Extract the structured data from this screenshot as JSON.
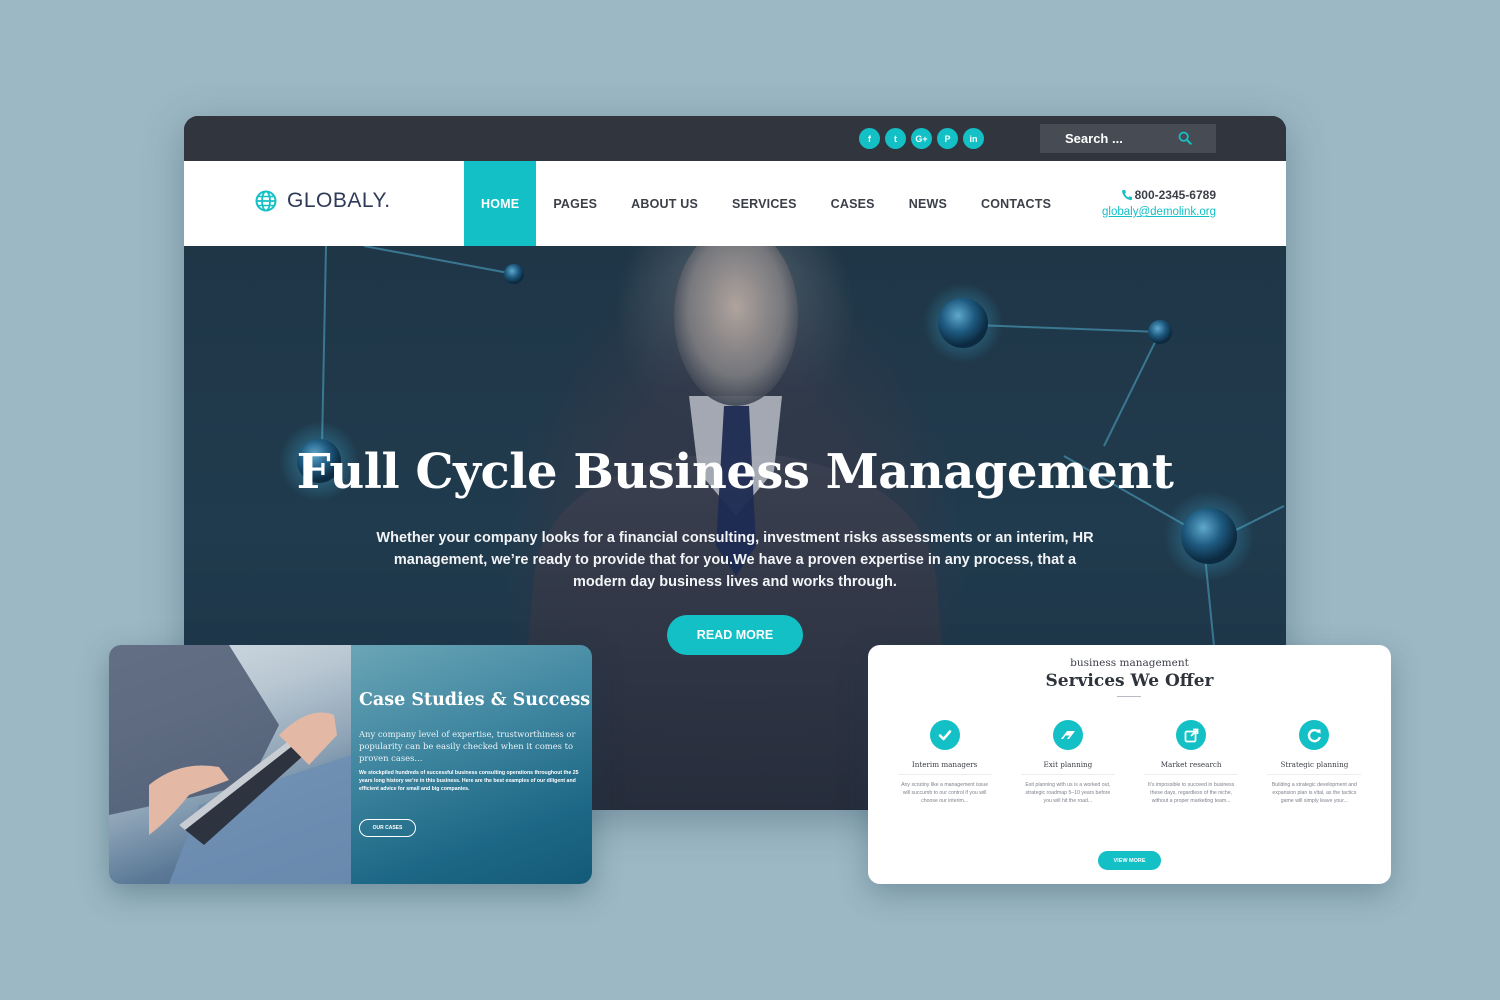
{
  "colors": {
    "background": "#9cb8c4",
    "accent": "#12c0c6",
    "topbar": "#30353e",
    "text_dark": "#3b3f47",
    "logo_text": "#2d3a58"
  },
  "topbar": {
    "social": [
      {
        "icon": "facebook-icon",
        "glyph": "f"
      },
      {
        "icon": "twitter-icon",
        "glyph": "t"
      },
      {
        "icon": "google-plus-icon",
        "glyph": "G+"
      },
      {
        "icon": "pinterest-icon",
        "glyph": "P"
      },
      {
        "icon": "linkedin-icon",
        "glyph": "in"
      }
    ],
    "search": {
      "placeholder": "Search ...",
      "icon": "search-icon"
    }
  },
  "header": {
    "logo_text": "GLOBALY.",
    "logo_icon": "globe-icon",
    "nav": [
      {
        "label": "HOME",
        "active": true
      },
      {
        "label": "PAGES",
        "active": false
      },
      {
        "label": "ABOUT US",
        "active": false
      },
      {
        "label": "SERVICES",
        "active": false
      },
      {
        "label": "CASES",
        "active": false
      },
      {
        "label": "NEWS",
        "active": false
      },
      {
        "label": "CONTACTS",
        "active": false
      }
    ],
    "phone": "800-2345-6789",
    "phone_icon": "phone-icon",
    "email": "globaly@demolink.org"
  },
  "hero": {
    "title": "Full Cycle Business Management",
    "text": "Whether your company looks for a financial consulting, investment risks assessments or an interim, HR management, we’re ready to provide that for you.We have a proven expertise in any process, that a modern day business lives and works through.",
    "button": "READ MORE"
  },
  "case_studies": {
    "title": "Case Studies & Success",
    "lead": "Any company level of expertise, trustworthiness or popularity can be easily checked when it comes to proven cases...",
    "body": "We stockpiled hundreds of successful business consulting operations throughout the 25 years long history we’re in this business. Here are the best examples of our diligent and efficient advice for small and big companies.",
    "button": "OUR CASES"
  },
  "services": {
    "subtitle": "business management",
    "title": "Services We Offer",
    "items": [
      {
        "label": "Interim managers",
        "icon": "checkmark-icon",
        "desc": "Any scrutiny like a management issue will succumb to our control if you will choose our interim..."
      },
      {
        "label": "Exit planning",
        "icon": "eraser-icon",
        "desc": "Exit planning with us is a worked out, strategic roadmap 5–10 years before you will hit the road..."
      },
      {
        "label": "Market research",
        "icon": "external-link-icon",
        "desc": "It’s impossible to succeed in business these days, regardless of the niche, without a proper marketing team..."
      },
      {
        "label": "Strategic planning",
        "icon": "refresh-icon",
        "desc": "Building a strategic development and expansion plan is vital, as the tactics game will simply leave your..."
      }
    ],
    "button": "VIEW MORE"
  }
}
